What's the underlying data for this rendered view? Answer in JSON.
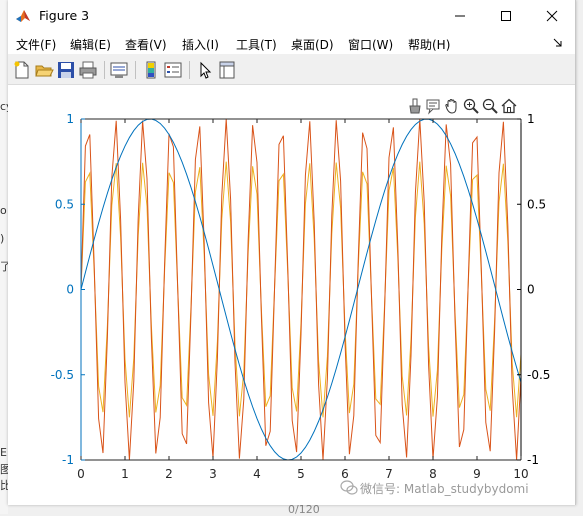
{
  "window": {
    "title": "Figure 3"
  },
  "menu": {
    "items": [
      "文件(F)",
      "编辑(E)",
      "查看(V)",
      "插入(I)",
      "工具(T)",
      "桌面(D)",
      "窗口(W)",
      "帮助(H)"
    ]
  },
  "background_fragments": [
    "cy",
    "o",
    ")",
    "了",
    "E",
    "图",
    "比",
    "0/120"
  ],
  "toolbar": {
    "icons": [
      "new-figure-icon",
      "open-file-icon",
      "save-icon",
      "print-icon",
      "link-plot-icon",
      "insert-colorbar-icon",
      "insert-legend-icon",
      "edit-plot-icon",
      "property-inspector-icon"
    ]
  },
  "axes_toolbar": {
    "icons": [
      "brush-icon",
      "datatips-icon",
      "pan-icon",
      "zoom-in-icon",
      "zoom-out-icon",
      "home-icon"
    ]
  },
  "watermark": {
    "text": "微信号: Matlab_studybydomi"
  },
  "chart_data": {
    "type": "line",
    "x_range": [
      0,
      10
    ],
    "x_ticks": [
      "0",
      "1",
      "2",
      "3",
      "4",
      "5",
      "6",
      "7",
      "8",
      "9",
      "10"
    ],
    "left_y": {
      "range": [
        -1,
        1
      ],
      "ticks": [
        "1",
        "0.5",
        "0",
        "-0.5",
        "-1"
      ],
      "color": "#0072bd"
    },
    "right_y": {
      "range": [
        -1,
        1
      ],
      "ticks": [
        "1",
        "0.5",
        "0",
        "-0.5",
        "-1"
      ],
      "color": "#000000"
    },
    "series": [
      {
        "function": "sin(x)",
        "axis": "left",
        "color": "#0072bd",
        "samples": 101
      },
      {
        "function": "sin(10x)",
        "axis": "right",
        "color": "#d95319",
        "samples": 101
      },
      {
        "function": "0.75*sin(10x)",
        "axis": "right",
        "color": "#edb120",
        "samples": 101
      }
    ]
  }
}
